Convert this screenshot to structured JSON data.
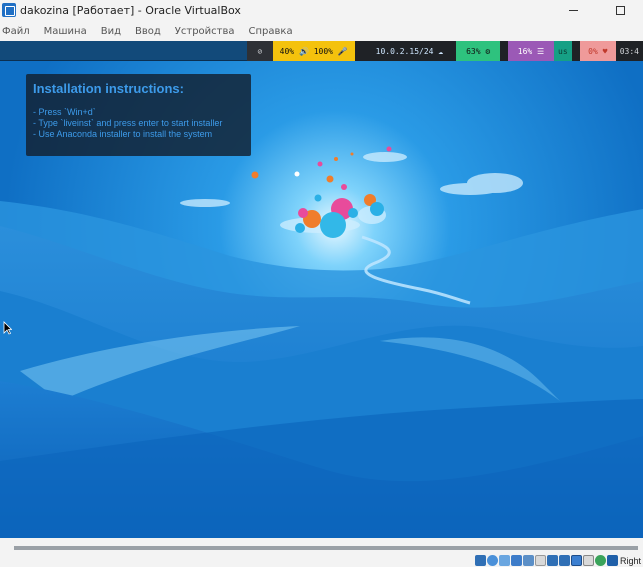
{
  "window": {
    "title": "dakozina [Работает] - Oracle VirtualBox",
    "app_icon": "virtualbox-icon",
    "minimize_icon": "minimize-icon",
    "maximize_icon": "maximize-icon"
  },
  "menu": {
    "items": [
      "Файл",
      "Машина",
      "Вид",
      "Ввод",
      "Устройства",
      "Справка"
    ]
  },
  "panel": {
    "eye_icon": "eye-off-icon",
    "audio": "40% 🔊 100% 🎤",
    "network": "10.0.2.15/24 ☁",
    "cpu": "63% ⚙",
    "memory": "16% ☰",
    "keyboard_layout": "us",
    "battery": "0% ♥",
    "clock": "03:4",
    "colors": {
      "audio": "#f4c20d",
      "cpu": "#2ec27e",
      "memory": "#9b59b6",
      "keyboard": "#16a085",
      "battery": "#ef9a9a"
    }
  },
  "instructions": {
    "title": "Installation instructions:",
    "lines": [
      "- Press `Win+d`",
      "- Type `liveinst` and press enter to start installer",
      "- Use Anaconda installer to install the system"
    ]
  },
  "statusbar": {
    "icons": [
      "hdd-icon",
      "optical-drive-icon",
      "audio-icon",
      "network-icon",
      "usb-icon",
      "shared-folders-icon",
      "display-icon",
      "video-capture-icon",
      "recording-icon",
      "cpu-indicator-icon",
      "mouse-integration-icon",
      "keyboard-icon"
    ],
    "host_key": "Right"
  }
}
